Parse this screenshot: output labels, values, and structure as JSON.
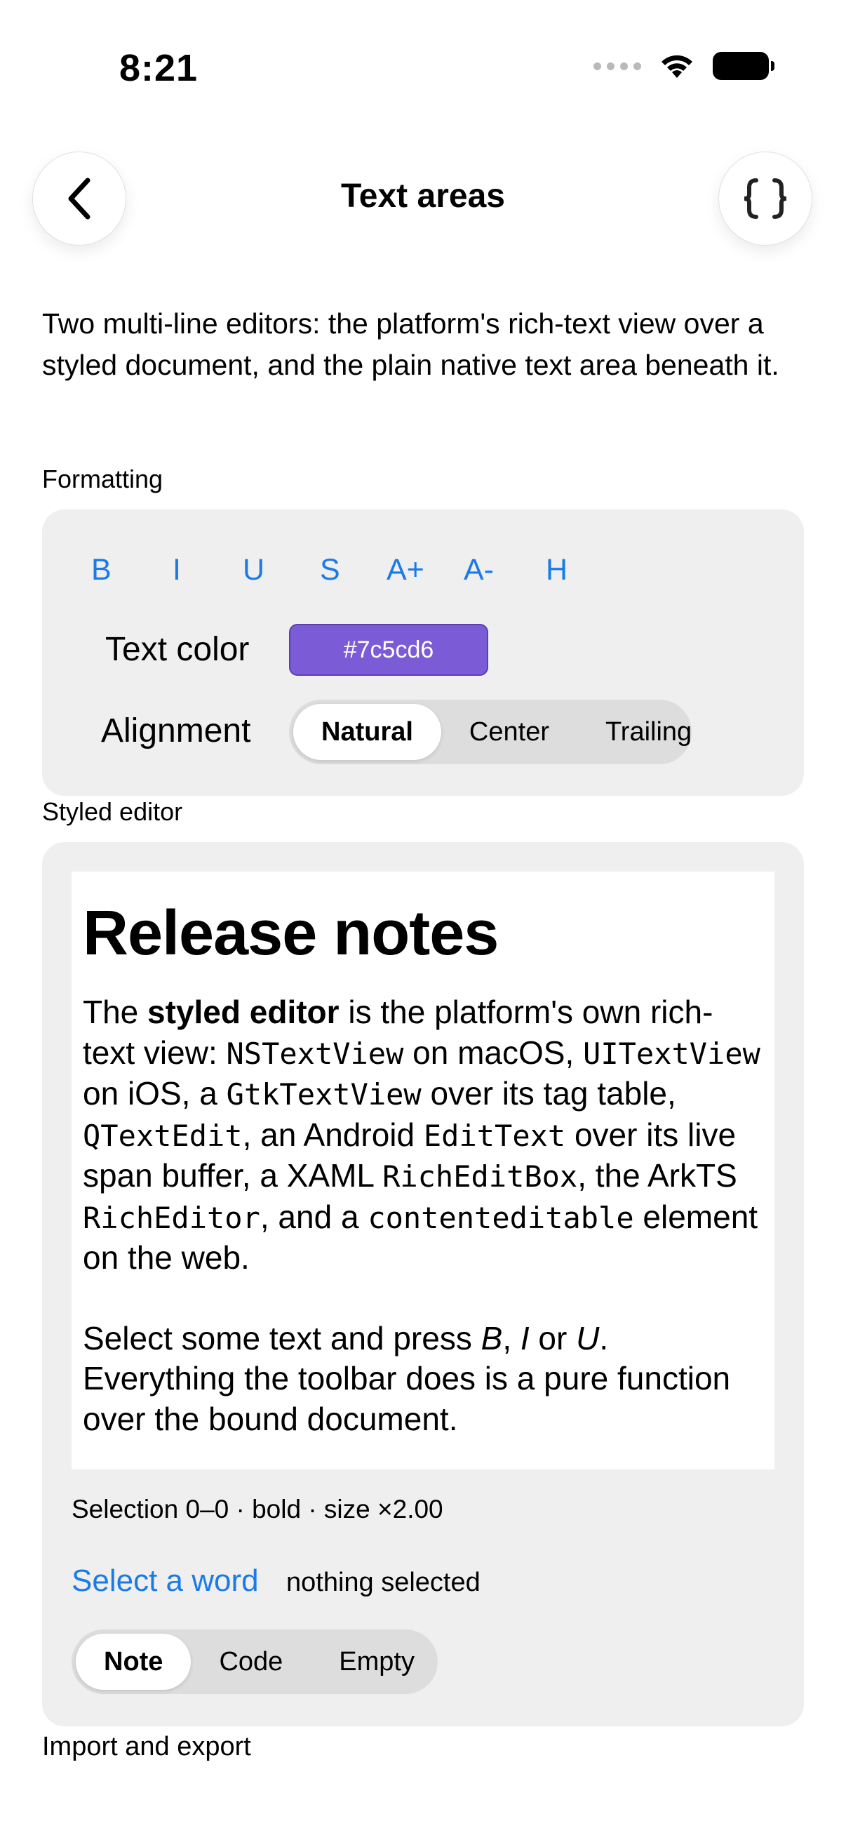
{
  "status_bar": {
    "time": "8:21"
  },
  "nav": {
    "title": "Text areas",
    "back_icon": "chevron-left-icon",
    "code_icon": "braces-icon"
  },
  "intro": "Two multi-line editors: the platform's rich-text view over a styled document, and the plain native text area beneath it.",
  "formatting": {
    "label": "Formatting",
    "buttons": [
      "B",
      "I",
      "U",
      "S",
      "A+",
      "A-",
      "H"
    ],
    "text_color_label": "Text color",
    "text_color_value": "#7c5cd6",
    "alignment_label": "Alignment",
    "alignment_options": [
      "Natural",
      "Center",
      "Trailing"
    ],
    "alignment_selected": "Natural",
    "accent": "#1a7be8"
  },
  "styled_editor": {
    "label": "Styled editor",
    "heading": "Release notes",
    "p1": {
      "a": "The ",
      "b_bold": "styled editor",
      "c": " is the platform's own rich-text view: ",
      "m1": "NSTextView",
      "d": " on macOS, ",
      "m2": "UITextView",
      "e": " on iOS, a ",
      "m3": "GtkTextView",
      "f": " over its tag table, ",
      "m4": "QTextEdit",
      "g": ", an Android ",
      "m5": "EditText",
      "h": " over its live span buffer, a XAML ",
      "m6": "RichEditBox",
      "i": ", the ArkTS ",
      "m7": "RichEditor",
      "j": ", and a ",
      "m8": "contenteditable",
      "k": " element on the web."
    },
    "p2": {
      "a": "Select some text and press ",
      "b": "B",
      "c": ", ",
      "d": "I",
      "e": " or ",
      "f": "U",
      "g": ". Everything the toolbar does is a pure function over the bound document."
    },
    "selection_info": "Selection 0–0 · bold · size ×2.00",
    "select_word_link": "Select a word",
    "selection_status": "nothing selected",
    "content_options": [
      "Note",
      "Code",
      "Empty"
    ],
    "content_selected": "Note"
  },
  "import_export": {
    "label": "Import and export"
  }
}
